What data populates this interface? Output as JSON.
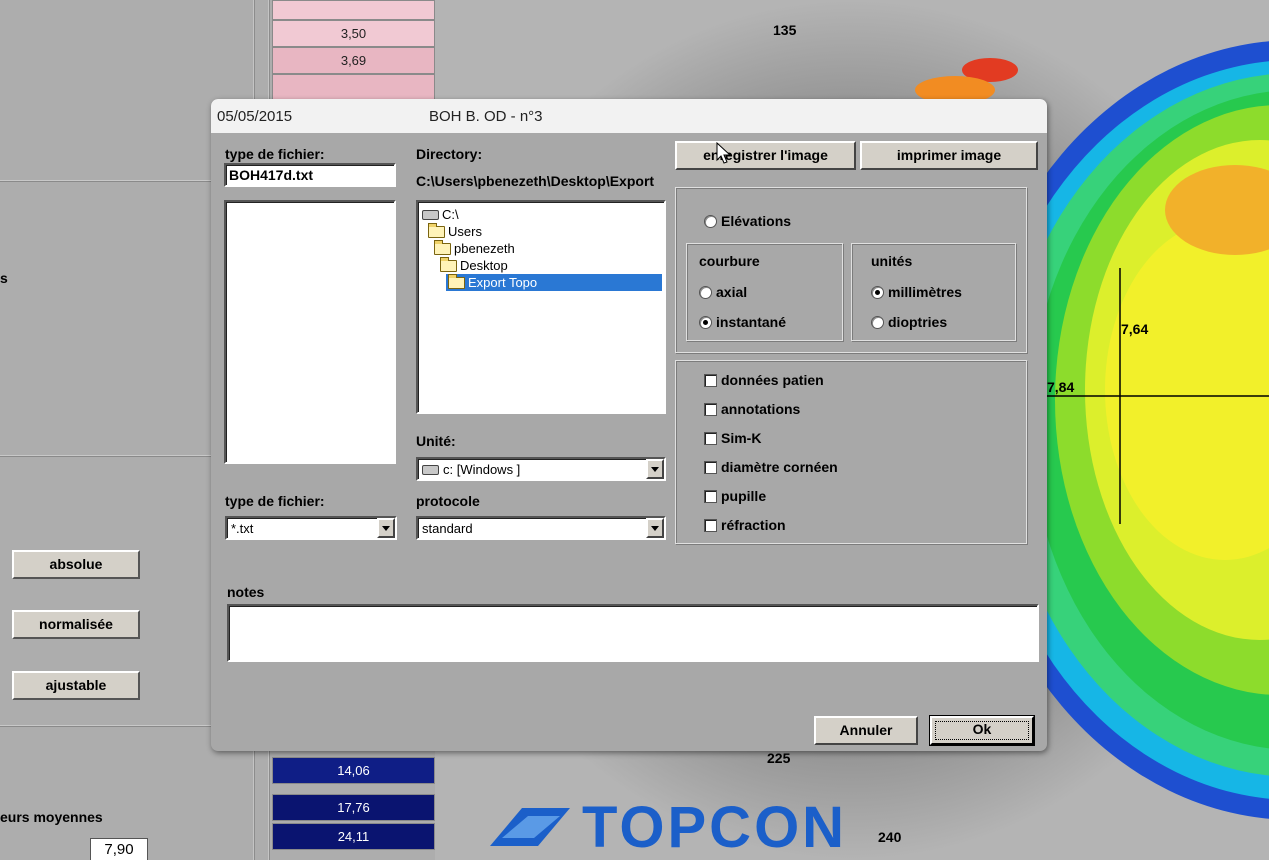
{
  "background": {
    "left_values_top": [
      "3,50",
      "3,69"
    ],
    "left_values_bottom": [
      "14,06",
      "17,76",
      "24,11"
    ],
    "side_buttons": [
      "absolue",
      "normalisée",
      "ajustable"
    ],
    "averages_label": "eurs moyennes",
    "averages_value": "7,90",
    "map": {
      "angle_top": "135",
      "angle_bottom_left": "225",
      "angle_bottom_right": "240",
      "measure_1": "7,64",
      "measure_2": "7,84"
    },
    "logo_text": "TOPCON"
  },
  "dialog": {
    "date": "05/05/2015",
    "title": "BOH B. OD - n°3",
    "filename_label": "type de fichier:",
    "filename_value": "BOH417d.txt",
    "directory_label": "Directory:",
    "directory_path": "C:\\Users\\pbenezeth\\Desktop\\Export",
    "tree": [
      "C:\\",
      "Users",
      "pbenezeth",
      "Desktop",
      "Export Topo"
    ],
    "unite_label": "Unité:",
    "drive_value": "c: [Windows ]",
    "filetype_label": "type de fichier:",
    "filetype_value": "*.txt",
    "protocole_label": "protocole",
    "protocole_value": "standard",
    "save_image_button": "enregistrer l'image",
    "print_image_button": "imprimer image",
    "elevations_label": "Elévations",
    "courbure_label": "courbure",
    "axial_label": "axial",
    "instantane_label": "instantané",
    "unites_label": "unités",
    "millimetres_label": "millimètres",
    "dioptries_label": "dioptries",
    "checkboxes": [
      "données patien",
      "annotations",
      "Sim-K",
      "diamètre cornéen",
      "pupille",
      "réfraction"
    ],
    "notes_label": "notes",
    "notes_value": "",
    "cancel_button": "Annuler",
    "ok_button": "Ok"
  }
}
